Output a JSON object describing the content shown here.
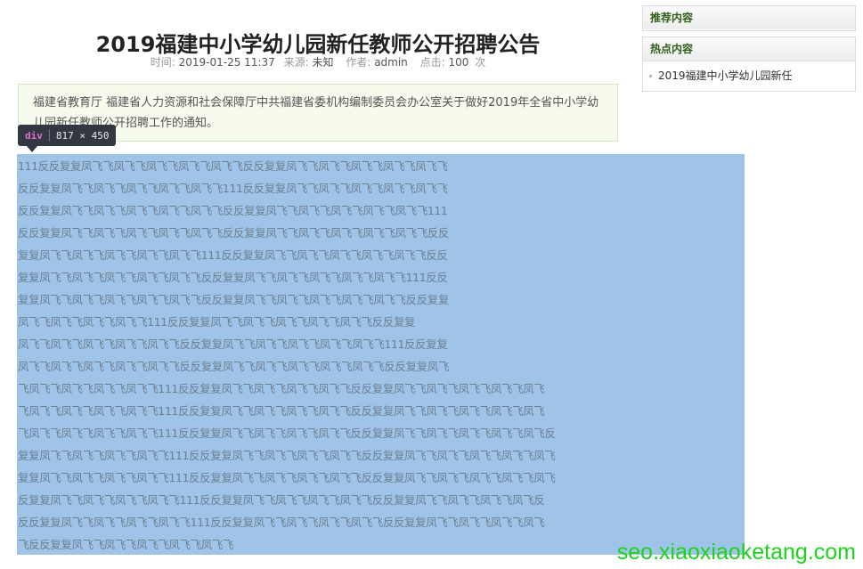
{
  "article": {
    "title": "2019福建中小学幼儿园新任教师公开招聘公告",
    "meta": {
      "time_label": "时间:",
      "time_value": "2019-01-25 11:37",
      "source_label": "来源:",
      "source_value": "未知",
      "author_label": "作者:",
      "author_value": "admin",
      "views_label": "点击:",
      "views_value": "100",
      "views_unit": "次"
    },
    "summary": "福建省教育厅 福建省人力资源和社会保障厅中共福建省委机构编制委员会办公室关于做好2019年全省中小学幼儿园新任教师公开招聘工作的通知。"
  },
  "inspector": {
    "tag": "div",
    "size": "817 × 450"
  },
  "content_lines": [
    "111反反复复凤飞飞凤飞飞凤飞飞凤飞飞凤飞飞反反复复凤飞飞凤飞飞凤飞飞凤飞飞凤飞飞",
    "反反复复凤飞飞凤飞飞凤飞飞凤飞飞凤飞飞111反反复复凤飞飞凤飞飞凤飞飞凤飞飞凤飞飞",
    "反反复复凤飞飞凤飞飞凤飞飞凤飞飞凤飞飞反反复复凤飞飞凤飞飞凤飞飞凤飞飞凤飞飞111",
    "反反复复凤飞飞凤飞飞凤飞飞凤飞飞凤飞飞反反复复凤飞飞凤飞飞凤飞飞凤飞飞凤飞飞反反",
    "复复凤飞飞凤飞飞凤飞飞凤飞飞凤飞飞111反反复复凤飞飞凤飞飞凤飞飞凤飞飞凤飞飞反反",
    "复复凤飞飞凤飞飞凤飞飞凤飞飞凤飞飞反反复复凤飞飞凤飞飞凤飞飞凤飞飞凤飞飞111反反",
    "复复凤飞飞凤飞飞凤飞飞凤飞飞凤飞飞反反复复凤飞飞凤飞飞凤飞飞凤飞飞凤飞飞反反复复",
    "凤飞飞凤飞飞凤飞飞凤飞飞111反反复复凤飞飞凤飞飞凤飞飞凤飞飞凤飞飞反反复复",
    "凤飞飞凤飞飞凤飞飞凤飞飞凤飞飞反反复复凤飞飞凤飞飞凤飞飞凤飞飞凤飞飞111反反复复",
    "凤飞飞凤飞飞凤飞飞凤飞飞凤飞飞反反复复凤飞飞凤飞飞凤飞飞凤飞飞凤飞飞反反复复凤飞",
    "飞凤飞飞凤飞飞凤飞飞凤飞飞111反反复复凤飞飞凤飞飞凤飞飞凤飞飞反反复复凤飞飞凤飞飞凤飞飞凤飞飞凤飞",
    "飞凤飞飞凤飞飞凤飞飞凤飞飞111反反复复凤飞飞凤飞飞凤飞飞凤飞飞反反复复凤飞飞凤飞飞凤飞飞凤飞飞凤飞",
    "飞凤飞飞凤飞飞凤飞飞凤飞飞111反反复复凤飞飞凤飞飞凤飞飞凤飞飞反反复复凤飞飞凤飞飞凤飞飞凤飞飞凤飞反",
    "复复凤飞飞凤飞飞凤飞飞凤飞飞111反反复复凤飞飞凤飞飞凤飞飞凤飞飞反反复复凤飞飞凤飞飞凤飞飞凤飞飞凤飞",
    "复复凤飞飞凤飞飞凤飞飞凤飞飞111反反复复凤飞飞凤飞飞凤飞飞凤飞飞反反复复凤飞飞凤飞飞凤飞飞凤飞飞凤飞",
    "反复复凤飞飞凤飞飞凤飞飞凤飞飞111反反复复凤飞飞凤飞飞凤飞飞凤飞飞反反复复凤飞飞凤飞飞凤飞飞凤飞反",
    "反反复复凤飞飞凤飞飞凤飞飞凤飞飞111反反复复凤飞飞凤飞飞凤飞飞凤飞飞反反复复凤飞飞凤飞飞凤飞飞凤飞",
    "飞反反复复凤飞飞凤飞飞凤飞飞凤飞飞凤飞飞"
  ],
  "sidebar": {
    "recommend_title": "推荐内容",
    "hot_title": "热点内容",
    "hot_items": [
      "2019福建中小学幼儿园新任"
    ]
  },
  "watermark": "seo.xiaoxiaoketang.com"
}
